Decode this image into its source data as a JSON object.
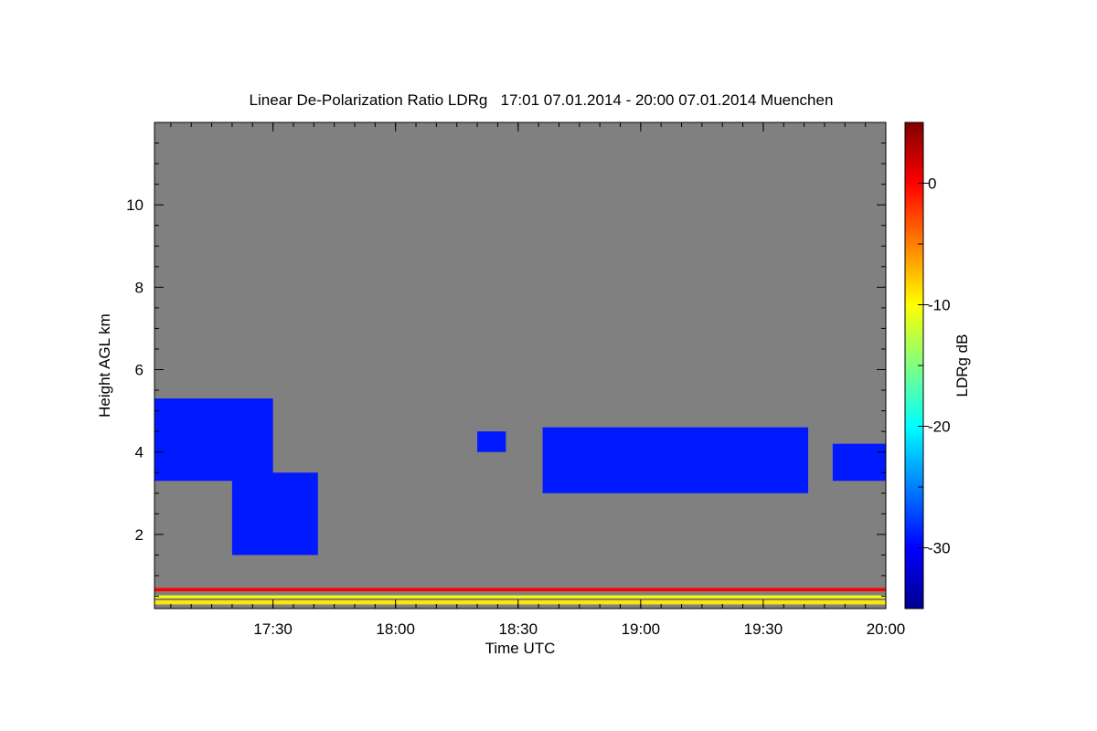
{
  "chart_data": {
    "type": "heatmap",
    "title": "Linear De-Polarization Ratio LDRg   17:01 07.01.2014 - 20:00 07.01.2014 Muenchen",
    "xlabel": "Time UTC",
    "ylabel": "Height AGL km",
    "xlim": [
      "17:01",
      "20:00"
    ],
    "ylim": [
      0.2,
      12.0
    ],
    "x_ticks": [
      "17:30",
      "18:00",
      "18:30",
      "19:00",
      "19:30",
      "20:00"
    ],
    "y_ticks": [
      2,
      4,
      6,
      8,
      10
    ],
    "colorbar": {
      "label": "LDRg dB",
      "range": [
        -35,
        5
      ],
      "ticks": [
        0,
        -10,
        -20,
        -30
      ],
      "colormap": "jet"
    },
    "background_color": "#808080",
    "features": [
      {
        "time_start": "17:01",
        "time_end": "17:30",
        "height_bottom": 3.3,
        "height_top": 5.3,
        "ldr_db": -29
      },
      {
        "time_start": "17:20",
        "time_end": "17:41",
        "height_bottom": 1.5,
        "height_top": 3.5,
        "ldr_db": -29
      },
      {
        "time_start": "18:20",
        "time_end": "18:27",
        "height_bottom": 4.0,
        "height_top": 4.5,
        "ldr_db": -29
      },
      {
        "time_start": "18:36",
        "time_end": "19:41",
        "height_bottom": 3.0,
        "height_top": 4.6,
        "ldr_db": -29
      },
      {
        "time_start": "19:47",
        "time_end": "20:00",
        "height_bottom": 3.3,
        "height_top": 4.2,
        "ldr_db": -29
      },
      {
        "time_start": "17:01",
        "time_end": "20:00",
        "height_bottom": 0.62,
        "height_top": 0.7,
        "ldr_db": 0
      },
      {
        "time_start": "17:01",
        "time_end": "20:00",
        "height_bottom": 0.45,
        "height_top": 0.52,
        "ldr_db": -10
      },
      {
        "time_start": "17:01",
        "time_end": "20:00",
        "height_bottom": 0.3,
        "height_top": 0.4,
        "ldr_db": -9
      }
    ]
  }
}
